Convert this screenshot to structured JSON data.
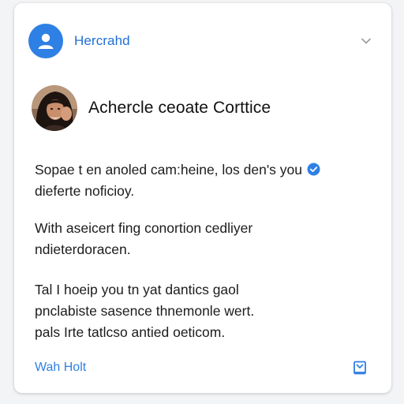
{
  "header": {
    "account_name": "Hercrahd"
  },
  "profile": {
    "name": "Achercle ceoate Corttice"
  },
  "body": {
    "paragraphs": [
      {
        "lines": [
          "Sopae t en anoled cam:heine, los den's you",
          "dieferte noficioy."
        ]
      },
      {
        "lines": [
          "With aseicert fing conortion cedliyer",
          "ndieterdoracen."
        ]
      },
      {
        "lines": [
          "Tal I hoeip you tn yat dantics gaol",
          "pnclabiste sasence thnemonle wert.",
          "pals Irte tatlcso antied oeticom."
        ]
      }
    ]
  },
  "footer": {
    "link_label": "Wah Holt"
  },
  "colors": {
    "accent": "#2f80e4",
    "card": "#ffffff",
    "background": "#f3f4f6"
  },
  "icons": {
    "account": "account-circle-icon",
    "chevron": "chevron-down-icon",
    "verified": "verified-check-icon",
    "footer": "bookmark-icon"
  }
}
